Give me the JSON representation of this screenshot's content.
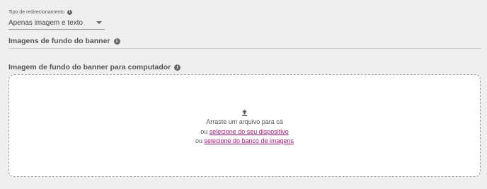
{
  "redirect": {
    "label": "Tipo de redirecionamento",
    "value": "Apenas imagem e texto"
  },
  "banner_images": {
    "title": "Imagens de fundo do banner"
  },
  "desktop_banner": {
    "title": "Imagem de fundo do banner para computador",
    "dropzone": {
      "drag_text": "Arraste um arquivo para cá",
      "or1": "ou",
      "device_link": "selecione do seu dispositivo",
      "or2": "ou",
      "bank_link": "selecione do banco de imagens"
    }
  },
  "icons": {
    "info": "info-icon",
    "caret": "chevron-down-icon",
    "upload": "upload-icon"
  },
  "colors": {
    "link": "#c2107a",
    "background": "#efefef",
    "dropzone_bg": "#ffffff"
  }
}
